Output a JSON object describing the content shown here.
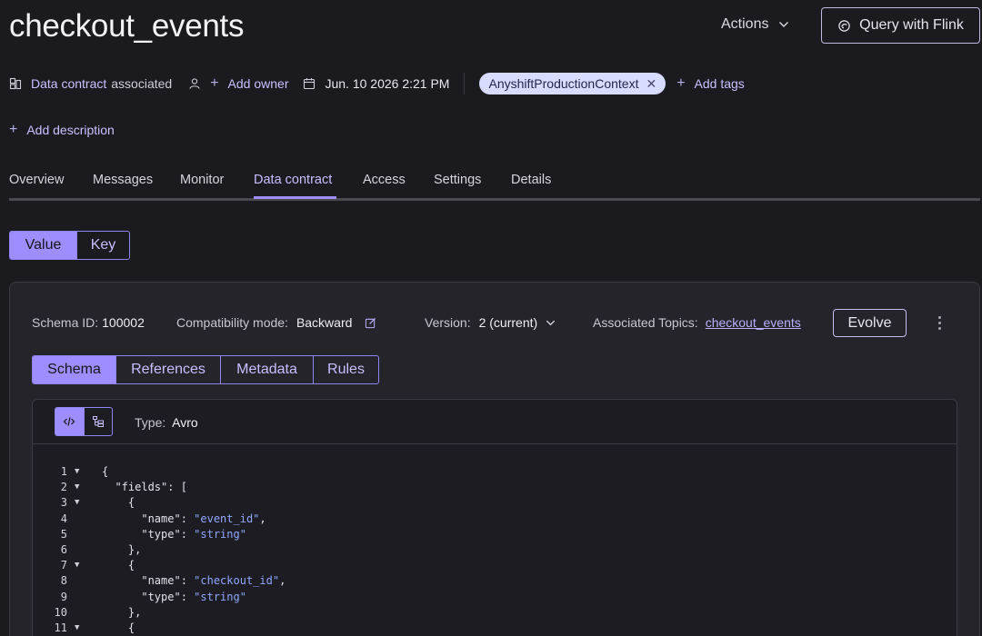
{
  "header": {
    "title": "checkout_events",
    "actions_label": "Actions",
    "flink_button_label": "Query with Flink"
  },
  "meta": {
    "data_contract_link": "Data contract",
    "data_contract_status": "associated",
    "add_owner_label": "Add owner",
    "timestamp": "Jun. 10 2026 2:21 PM",
    "tag": "AnyshiftProductionContext",
    "add_tags_label": "Add tags"
  },
  "add_description_label": "Add description",
  "tabs": [
    {
      "label": "Overview"
    },
    {
      "label": "Messages"
    },
    {
      "label": "Monitor"
    },
    {
      "label": "Data contract",
      "active": true
    },
    {
      "label": "Access"
    },
    {
      "label": "Settings"
    },
    {
      "label": "Details"
    }
  ],
  "value_key_toggle": {
    "options": [
      "Value",
      "Key"
    ],
    "selected": "Value"
  },
  "schema": {
    "id_label": "Schema ID:",
    "id_value": "100002",
    "compat_label": "Compatibility mode:",
    "compat_value": "Backward",
    "version_label": "Version:",
    "version_value": "2 (current)",
    "assoc_label": "Associated Topics:",
    "assoc_value": "checkout_events",
    "evolve_label": "Evolve"
  },
  "subtabs": {
    "options": [
      "Schema",
      "References",
      "Metadata",
      "Rules"
    ],
    "selected": "Schema"
  },
  "editor": {
    "type_label": "Type:",
    "type_value": "Avro",
    "lines": [
      {
        "n": "1",
        "fold": true,
        "text": "{"
      },
      {
        "n": "2",
        "fold": true,
        "text": "  \"fields\": ["
      },
      {
        "n": "3",
        "fold": true,
        "text": "    {"
      },
      {
        "n": "4",
        "fold": false,
        "text": "      \"name\": ",
        "str": "\"event_id\"",
        "tail": ","
      },
      {
        "n": "5",
        "fold": false,
        "text": "      \"type\": ",
        "str": "\"string\"",
        "tail": ""
      },
      {
        "n": "6",
        "fold": false,
        "text": "    },"
      },
      {
        "n": "7",
        "fold": true,
        "text": "    {"
      },
      {
        "n": "8",
        "fold": false,
        "text": "      \"name\": ",
        "str": "\"checkout_id\"",
        "tail": ","
      },
      {
        "n": "9",
        "fold": false,
        "text": "      \"type\": ",
        "str": "\"string\"",
        "tail": ""
      },
      {
        "n": "10",
        "fold": false,
        "text": "    },"
      },
      {
        "n": "11",
        "fold": true,
        "text": "    {"
      }
    ]
  },
  "icons": {
    "actions_chevron": "chevron-down-icon",
    "flink": "flink-icon",
    "data_contract": "contract-icon",
    "owner": "user-icon",
    "calendar": "calendar-icon",
    "edit": "edit-icon",
    "version_chevron": "chevron-down-icon",
    "kebab": "more-vertical-icon",
    "code_view": "code-icon",
    "tree_view": "tree-icon"
  },
  "colors": {
    "background": "#1b1a1f",
    "accent": "#9d8dfd",
    "link": "#c9c2ff",
    "tag_bg": "#d8dcff",
    "string_literal": "#8fa8ff"
  }
}
